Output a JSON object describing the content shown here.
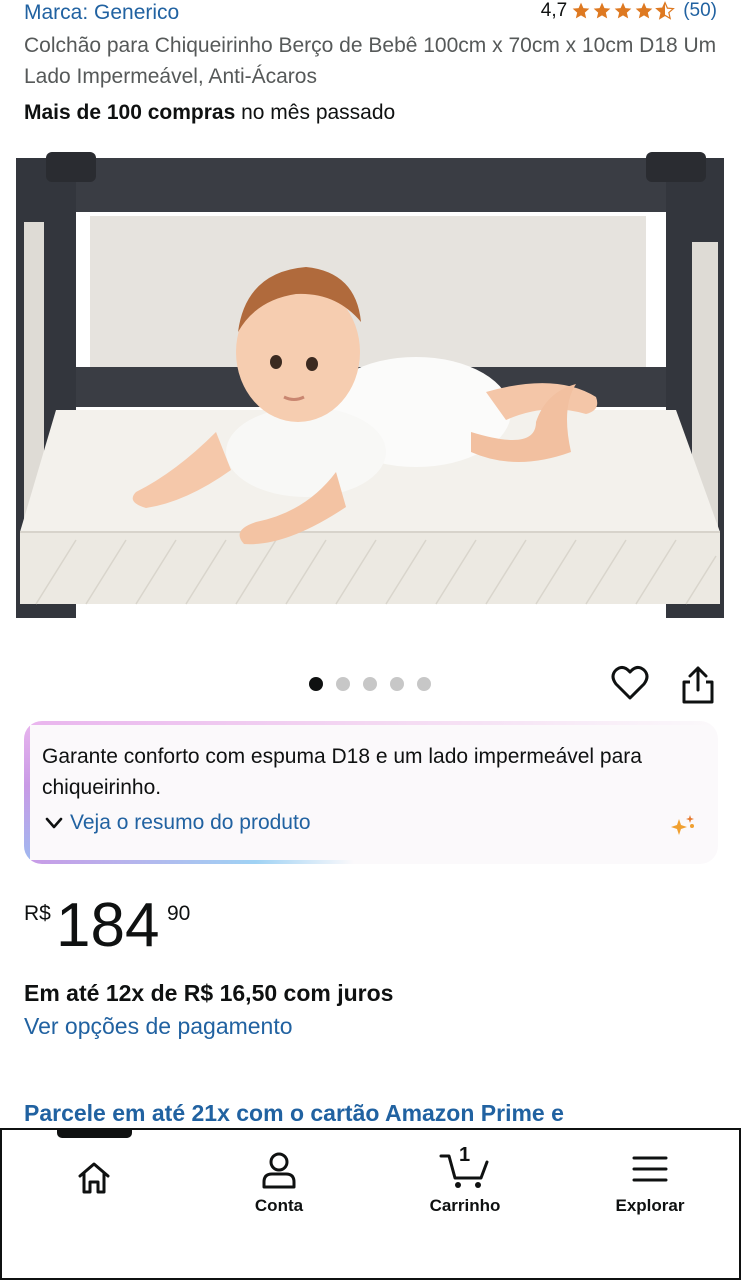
{
  "brand": {
    "label": "Marca: Generico"
  },
  "rating": {
    "value": "4,7",
    "stars": 4.5,
    "count": "(50)",
    "star_color": "#de7921"
  },
  "product": {
    "title": "Colchão para Chiqueirinho Berço de Bebê 100cm x 70cm x 10cm D18 Um Lado Impermeável, Anti-Ácaros",
    "purchases_bold": "Mais de 100 compras",
    "purchases_rest": " no mês passado"
  },
  "gallery": {
    "total_images": 5,
    "active_index": 0
  },
  "summary": {
    "text": "Garante conforto com espuma D18 e um lado impermeável para chiqueirinho.",
    "link": "Veja o resumo do produto"
  },
  "price": {
    "currency": "R$",
    "whole": "184",
    "fraction": "90"
  },
  "installments": "Em até 12x de R$ 16,50 com juros",
  "payment_link": "Ver opções de pagamento",
  "prime_card": "Parcele em até 21x com o cartão Amazon Prime e",
  "nav": {
    "conta": "Conta",
    "carrinho": "Carrinho",
    "cart_count": "1",
    "explorar": "Explorar"
  },
  "colors": {
    "link": "#2162a1",
    "text": "#0f1111",
    "muted": "#565959"
  }
}
